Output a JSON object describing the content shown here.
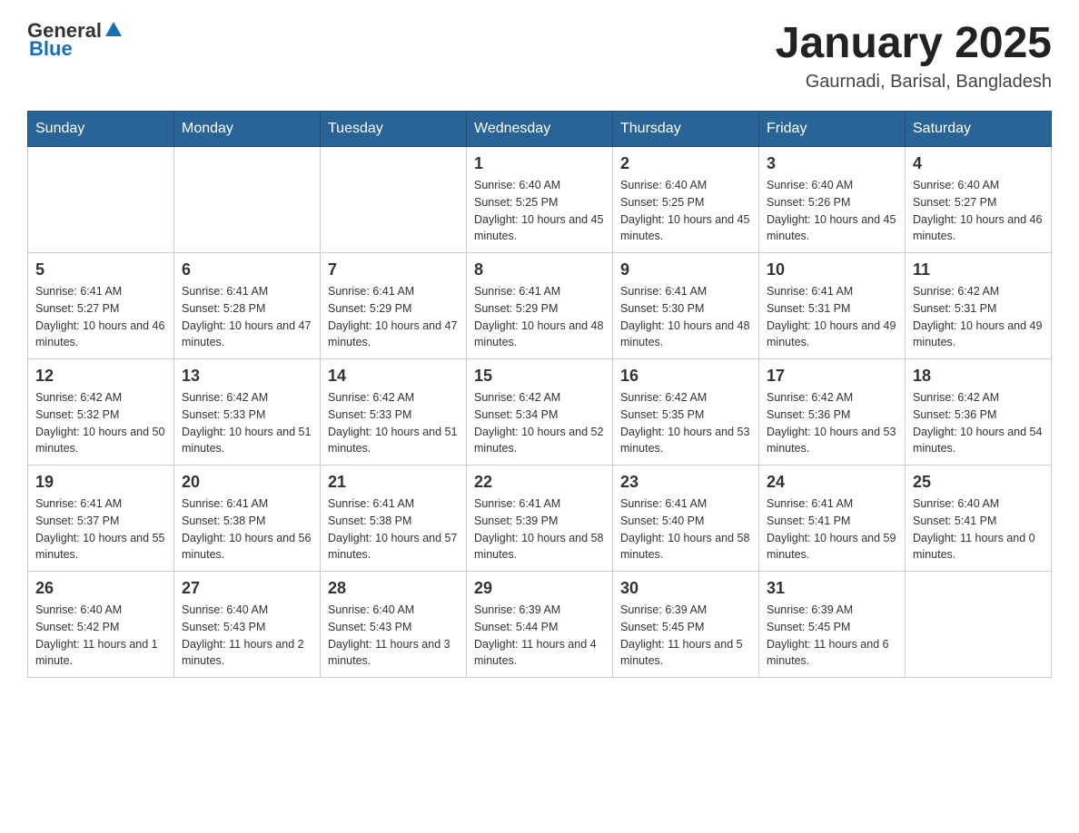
{
  "header": {
    "logo": {
      "text_general": "General",
      "text_blue": "Blue"
    },
    "title": "January 2025",
    "location": "Gaurnadi, Barisal, Bangladesh"
  },
  "days_of_week": [
    "Sunday",
    "Monday",
    "Tuesday",
    "Wednesday",
    "Thursday",
    "Friday",
    "Saturday"
  ],
  "weeks": [
    [
      {
        "day": "",
        "info": ""
      },
      {
        "day": "",
        "info": ""
      },
      {
        "day": "",
        "info": ""
      },
      {
        "day": "1",
        "info": "Sunrise: 6:40 AM\nSunset: 5:25 PM\nDaylight: 10 hours and 45 minutes."
      },
      {
        "day": "2",
        "info": "Sunrise: 6:40 AM\nSunset: 5:25 PM\nDaylight: 10 hours and 45 minutes."
      },
      {
        "day": "3",
        "info": "Sunrise: 6:40 AM\nSunset: 5:26 PM\nDaylight: 10 hours and 45 minutes."
      },
      {
        "day": "4",
        "info": "Sunrise: 6:40 AM\nSunset: 5:27 PM\nDaylight: 10 hours and 46 minutes."
      }
    ],
    [
      {
        "day": "5",
        "info": "Sunrise: 6:41 AM\nSunset: 5:27 PM\nDaylight: 10 hours and 46 minutes."
      },
      {
        "day": "6",
        "info": "Sunrise: 6:41 AM\nSunset: 5:28 PM\nDaylight: 10 hours and 47 minutes."
      },
      {
        "day": "7",
        "info": "Sunrise: 6:41 AM\nSunset: 5:29 PM\nDaylight: 10 hours and 47 minutes."
      },
      {
        "day": "8",
        "info": "Sunrise: 6:41 AM\nSunset: 5:29 PM\nDaylight: 10 hours and 48 minutes."
      },
      {
        "day": "9",
        "info": "Sunrise: 6:41 AM\nSunset: 5:30 PM\nDaylight: 10 hours and 48 minutes."
      },
      {
        "day": "10",
        "info": "Sunrise: 6:41 AM\nSunset: 5:31 PM\nDaylight: 10 hours and 49 minutes."
      },
      {
        "day": "11",
        "info": "Sunrise: 6:42 AM\nSunset: 5:31 PM\nDaylight: 10 hours and 49 minutes."
      }
    ],
    [
      {
        "day": "12",
        "info": "Sunrise: 6:42 AM\nSunset: 5:32 PM\nDaylight: 10 hours and 50 minutes."
      },
      {
        "day": "13",
        "info": "Sunrise: 6:42 AM\nSunset: 5:33 PM\nDaylight: 10 hours and 51 minutes."
      },
      {
        "day": "14",
        "info": "Sunrise: 6:42 AM\nSunset: 5:33 PM\nDaylight: 10 hours and 51 minutes."
      },
      {
        "day": "15",
        "info": "Sunrise: 6:42 AM\nSunset: 5:34 PM\nDaylight: 10 hours and 52 minutes."
      },
      {
        "day": "16",
        "info": "Sunrise: 6:42 AM\nSunset: 5:35 PM\nDaylight: 10 hours and 53 minutes."
      },
      {
        "day": "17",
        "info": "Sunrise: 6:42 AM\nSunset: 5:36 PM\nDaylight: 10 hours and 53 minutes."
      },
      {
        "day": "18",
        "info": "Sunrise: 6:42 AM\nSunset: 5:36 PM\nDaylight: 10 hours and 54 minutes."
      }
    ],
    [
      {
        "day": "19",
        "info": "Sunrise: 6:41 AM\nSunset: 5:37 PM\nDaylight: 10 hours and 55 minutes."
      },
      {
        "day": "20",
        "info": "Sunrise: 6:41 AM\nSunset: 5:38 PM\nDaylight: 10 hours and 56 minutes."
      },
      {
        "day": "21",
        "info": "Sunrise: 6:41 AM\nSunset: 5:38 PM\nDaylight: 10 hours and 57 minutes."
      },
      {
        "day": "22",
        "info": "Sunrise: 6:41 AM\nSunset: 5:39 PM\nDaylight: 10 hours and 58 minutes."
      },
      {
        "day": "23",
        "info": "Sunrise: 6:41 AM\nSunset: 5:40 PM\nDaylight: 10 hours and 58 minutes."
      },
      {
        "day": "24",
        "info": "Sunrise: 6:41 AM\nSunset: 5:41 PM\nDaylight: 10 hours and 59 minutes."
      },
      {
        "day": "25",
        "info": "Sunrise: 6:40 AM\nSunset: 5:41 PM\nDaylight: 11 hours and 0 minutes."
      }
    ],
    [
      {
        "day": "26",
        "info": "Sunrise: 6:40 AM\nSunset: 5:42 PM\nDaylight: 11 hours and 1 minute."
      },
      {
        "day": "27",
        "info": "Sunrise: 6:40 AM\nSunset: 5:43 PM\nDaylight: 11 hours and 2 minutes."
      },
      {
        "day": "28",
        "info": "Sunrise: 6:40 AM\nSunset: 5:43 PM\nDaylight: 11 hours and 3 minutes."
      },
      {
        "day": "29",
        "info": "Sunrise: 6:39 AM\nSunset: 5:44 PM\nDaylight: 11 hours and 4 minutes."
      },
      {
        "day": "30",
        "info": "Sunrise: 6:39 AM\nSunset: 5:45 PM\nDaylight: 11 hours and 5 minutes."
      },
      {
        "day": "31",
        "info": "Sunrise: 6:39 AM\nSunset: 5:45 PM\nDaylight: 11 hours and 6 minutes."
      },
      {
        "day": "",
        "info": ""
      }
    ]
  ]
}
